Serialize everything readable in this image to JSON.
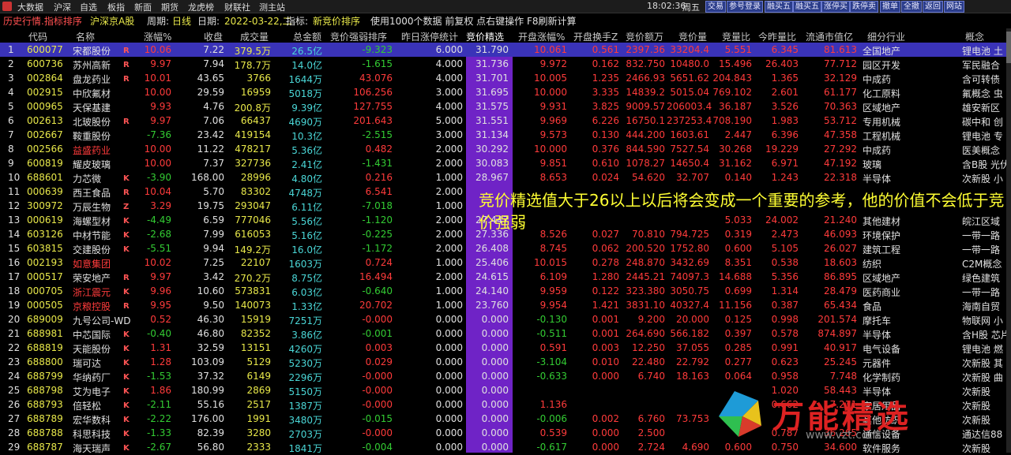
{
  "menubar": {
    "items": [
      "大数据",
      "沪深",
      "自选",
      "板指",
      "新面",
      "期货",
      "龙虎榜",
      "财联社",
      "测主站"
    ],
    "time": "18:02:36",
    "week": "周五",
    "buttons": [
      "交易",
      "参号登录",
      "融买五",
      "融买五",
      "涨停买",
      "跌停卖",
      "撤单",
      "全撤",
      "返回",
      "网站"
    ]
  },
  "titlebar": {
    "crumb": "历史行情.指标排序",
    "market": "沪深京A股",
    "period_label": "周期:",
    "period": "日线",
    "date_label": "日期:",
    "date": "2022-03-22,二",
    "indicator_label": "指标:",
    "indicator": "新竞价排序",
    "note": "使用1000个数据 前复权 点右键操作 F8刷新计算"
  },
  "columns": [
    "代码",
    "名称",
    "涨幅%",
    "收盘",
    "成交量",
    "总金额",
    "竞价强弱排序",
    "昨日涨停统计",
    "竞价精选",
    "开盘涨幅%",
    "开盘换手Z",
    "竞价额万",
    "竞价量",
    "竞量比",
    "今昨量比",
    "流通市值亿",
    "细分行业",
    "概念"
  ],
  "rows": [
    [
      "1",
      "600077",
      "宋都股份",
      "10.06",
      "7.22",
      "379.5万",
      "26.5亿",
      "-9.323",
      "6.000",
      "31.790",
      "10.061",
      "0.561",
      "2397.36",
      "33204.4",
      "5.551",
      "6.345",
      "81.613",
      "全国地产",
      "锂电池 土"
    ],
    [
      "2",
      "600736",
      "苏州高新",
      "9.97",
      "7.94",
      "178.7万",
      "14.0亿",
      "-1.615",
      "4.000",
      "31.736",
      "9.972",
      "0.162",
      "832.750",
      "10480.0",
      "15.496",
      "26.403",
      "77.712",
      "园区开发",
      "军民融合"
    ],
    [
      "3",
      "002864",
      "盘龙药业",
      "10.01",
      "43.65",
      "3766",
      "1644万",
      "43.076",
      "4.000",
      "31.701",
      "10.005",
      "1.235",
      "2466.93",
      "5651.62",
      "204.843",
      "1.365",
      "32.129",
      "中成药",
      "含可转债"
    ],
    [
      "4",
      "002915",
      "中欣氟材",
      "10.00",
      "29.59",
      "16959",
      "5018万",
      "106.256",
      "3.000",
      "31.695",
      "10.000",
      "3.335",
      "14839.2",
      "5015.04",
      "769.102",
      "2.601",
      "61.177",
      "化工原料",
      "氟概念 虫"
    ],
    [
      "5",
      "000965",
      "天保基建",
      "9.93",
      "4.76",
      "200.8万",
      "9.39亿",
      "127.755",
      "4.000",
      "31.575",
      "9.931",
      "3.825",
      "9009.57",
      "206003.4",
      "36.187",
      "3.526",
      "70.363",
      "区域地产",
      "雄安新区"
    ],
    [
      "6",
      "002613",
      "北玻股份",
      "9.97",
      "7.06",
      "66437",
      "4690万",
      "201.643",
      "5.000",
      "31.551",
      "9.969",
      "6.226",
      "16750.1",
      "237253.4",
      "708.190",
      "1.983",
      "53.712",
      "专用机械",
      "碳中和 创"
    ],
    [
      "7",
      "002667",
      "鞍重股份",
      "-7.36",
      "23.42",
      "419154",
      "10.3亿",
      "-2.515",
      "3.000",
      "31.134",
      "9.573",
      "0.130",
      "444.200",
      "1603.61",
      "2.447",
      "6.396",
      "47.358",
      "工程机械",
      "锂电池 专"
    ],
    [
      "8",
      "002566",
      "益盛药业",
      "10.00",
      "11.22",
      "478217",
      "5.36亿",
      "0.482",
      "2.000",
      "30.292",
      "10.000",
      "0.376",
      "844.590",
      "7527.54",
      "30.268",
      "19.229",
      "27.292",
      "中成药",
      "医美概念"
    ],
    [
      "9",
      "600819",
      "耀皮玻璃",
      "10.00",
      "7.37",
      "327736",
      "2.41亿",
      "-1.431",
      "2.000",
      "30.083",
      "9.851",
      "0.610",
      "1078.27",
      "14650.4",
      "31.162",
      "6.971",
      "47.192",
      "玻璃",
      "含B股 光伏"
    ],
    [
      "10",
      "688601",
      "力芯微",
      "-3.90",
      "168.00",
      "28996",
      "4.80亿",
      "0.216",
      "1.000",
      "28.967",
      "8.653",
      "0.024",
      "54.620",
      "32.707",
      "0.140",
      "1.243",
      "22.318",
      "半导体",
      "次新股 小"
    ],
    [
      "11",
      "000639",
      "西王食品",
      "10.04",
      "5.70",
      "83302",
      "4748万",
      "6.541",
      "2.000",
      "",
      "",
      "",
      "",
      "",
      "",
      "",
      "",
      "",
      ""
    ],
    [
      "12",
      "300972",
      "万辰生物",
      "3.29",
      "19.75",
      "293047",
      "6.11亿",
      "-7.018",
      "1.000",
      "",
      "",
      "",
      "",
      "",
      "",
      "",
      "",
      "",
      ""
    ],
    [
      "13",
      "000619",
      "海螺型材",
      "-4.49",
      "6.59",
      "777046",
      "5.56亿",
      "-1.120",
      "2.000",
      "27.447",
      "",
      "",
      "",
      "",
      "5.033",
      "24.002",
      "21.240",
      "其他建材",
      "皖江区域"
    ],
    [
      "14",
      "603126",
      "中材节能",
      "-2.68",
      "7.99",
      "616053",
      "5.16亿",
      "-0.225",
      "2.000",
      "27.336",
      "8.526",
      "0.027",
      "70.810",
      "794.725",
      "0.319",
      "2.473",
      "46.093",
      "环境保护",
      "一带一路"
    ],
    [
      "15",
      "603815",
      "交建股份",
      "-5.51",
      "9.94",
      "149.2万",
      "16.0亿",
      "-1.172",
      "2.000",
      "26.408",
      "8.745",
      "0.062",
      "200.520",
      "1752.80",
      "0.600",
      "5.105",
      "26.027",
      "建筑工程",
      "一带一路"
    ],
    [
      "16",
      "002193",
      "如意集团",
      "10.02",
      "7.25",
      "22107",
      "1603万",
      "0.724",
      "1.000",
      "25.406",
      "10.015",
      "0.278",
      "248.870",
      "3432.69",
      "8.351",
      "0.538",
      "18.603",
      "纺织",
      "C2M概念"
    ],
    [
      "17",
      "000517",
      "荣安地产",
      "9.97",
      "3.42",
      "270.2万",
      "8.75亿",
      "16.494",
      "2.000",
      "24.615",
      "6.109",
      "1.280",
      "2445.21",
      "74097.3",
      "14.688",
      "5.356",
      "86.895",
      "区域地产",
      "绿色建筑"
    ],
    [
      "18",
      "000705",
      "浙江震元",
      "9.96",
      "10.60",
      "573831",
      "6.03亿",
      "-0.640",
      "1.000",
      "24.140",
      "9.959",
      "0.122",
      "323.380",
      "3050.75",
      "0.699",
      "1.314",
      "28.479",
      "医药商业",
      "一带一路"
    ],
    [
      "19",
      "000505",
      "京粮控股",
      "9.95",
      "9.50",
      "140073",
      "1.33亿",
      "20.702",
      "1.000",
      "23.760",
      "9.954",
      "1.421",
      "3831.10",
      "40327.4",
      "11.156",
      "0.387",
      "65.434",
      "食品",
      "海南自贸"
    ],
    [
      "20",
      "689009",
      "九号公司-WD",
      "0.52",
      "46.30",
      "15919",
      "7251万",
      "-0.000",
      "0.000",
      "0.000",
      "-0.130",
      "0.001",
      "9.200",
      "20.000",
      "0.125",
      "0.998",
      "201.574",
      "摩托车",
      "物联网 小"
    ],
    [
      "21",
      "688981",
      "中芯国际",
      "-0.40",
      "46.80",
      "82352",
      "3.86亿",
      "-0.001",
      "0.000",
      "0.000",
      "-0.511",
      "0.001",
      "264.690",
      "566.182",
      "0.397",
      "0.578",
      "874.897",
      "半导体",
      "含H股 芯片"
    ],
    [
      "22",
      "688819",
      "天能股份",
      "1.31",
      "32.59",
      "13151",
      "4260万",
      "0.003",
      "0.000",
      "0.000",
      "0.591",
      "0.003",
      "12.250",
      "37.055",
      "0.285",
      "0.991",
      "40.917",
      "电气设备",
      "锂电池 燃"
    ],
    [
      "23",
      "688800",
      "瑞可达",
      "1.28",
      "103.09",
      "5129",
      "5230万",
      "0.029",
      "0.000",
      "0.000",
      "-3.104",
      "0.010",
      "22.480",
      "22.792",
      "0.277",
      "0.623",
      "25.245",
      "元器件",
      "次新股 其"
    ],
    [
      "24",
      "688799",
      "华纳药厂",
      "-1.53",
      "37.32",
      "6149",
      "2296万",
      "-0.000",
      "0.000",
      "0.000",
      "-0.633",
      "0.000",
      "6.740",
      "18.163",
      "0.064",
      "0.958",
      "7.748",
      "化学制药",
      "次新股 曲"
    ],
    [
      "25",
      "688798",
      "艾为电子",
      "1.86",
      "180.99",
      "2869",
      "5150万",
      "-0.000",
      "0.000",
      "0.000",
      "",
      "",
      "",
      "",
      "",
      "1.020",
      "58.443",
      "半导体",
      "次新股"
    ],
    [
      "26",
      "688793",
      "倍轻松",
      "-2.11",
      "55.16",
      "2517",
      "1387万",
      "-0.000",
      "0.000",
      "0.000",
      "1.136",
      "",
      "",
      "",
      "",
      "0.662",
      "7.231",
      "家居用品",
      "次新股"
    ],
    [
      "27",
      "688789",
      "宏华数科",
      "-2.22",
      "176.00",
      "1991",
      "3480万",
      "-0.015",
      "0.000",
      "0.000",
      "-0.006",
      "0.002",
      "6.760",
      "73.753",
      "",
      "",
      "",
      "其他纺织",
      "次新股"
    ],
    [
      "28",
      "688788",
      "科思科技",
      "-1.33",
      "82.39",
      "3280",
      "2703万",
      "-0.000",
      "0.000",
      "0.000",
      "0.539",
      "0.000",
      "2.500",
      "",
      "",
      "0.787",
      "36.265",
      "通信设备",
      "通达信88"
    ],
    [
      "29",
      "688787",
      "海天瑞声",
      "-2.67",
      "56.80",
      "2333",
      "1841万",
      "-0.004",
      "0.000",
      "0.000",
      "-0.617",
      "0.000",
      "2.724",
      "4.690",
      "0.600",
      "0.750",
      "34.600",
      "软件服务",
      "次新股"
    ]
  ],
  "name_colors": {
    "8": "red",
    "16": "red",
    "18": "red",
    "19": "red"
  },
  "flags": {
    "1": "R",
    "2": "R",
    "3": "R",
    "4": "",
    "5": "",
    "6": "R",
    "7": "",
    "8": "",
    "9": "",
    "10": "K",
    "11": "R",
    "12": "Z",
    "13": "K",
    "14": "K",
    "15": "K",
    "16": "",
    "17": "R",
    "18": "K",
    "19": "R",
    "20": "",
    "21": "K",
    "22": "K",
    "23": "K",
    "24": "K",
    "25": "K",
    "26": "K",
    "27": "K",
    "28": "K",
    "29": "K"
  },
  "annotation": "竞价精选值大于26以上以后将会变成一个重要的参考，他的价值不会低于竞价强弱",
  "watermark": {
    "text": "万能精选",
    "url": "www.vzt.com"
  }
}
